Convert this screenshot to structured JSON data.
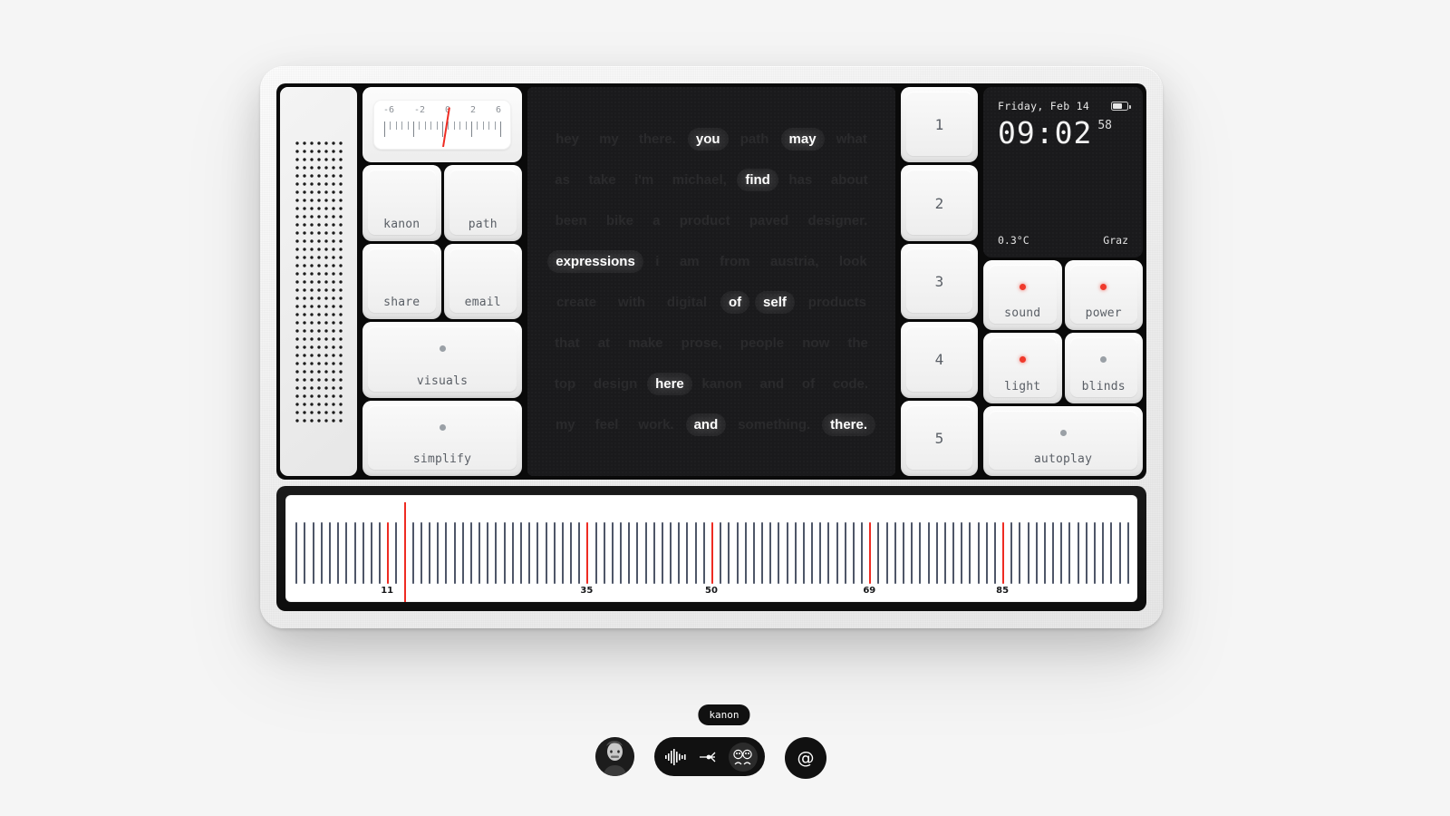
{
  "device": {
    "meter": {
      "scale_labels": [
        "-6",
        "-2",
        "0",
        "2",
        "6"
      ],
      "needle_value": "0"
    },
    "left_keys": [
      {
        "label": "kanon",
        "led": null
      },
      {
        "label": "path",
        "led": null
      },
      {
        "label": "share",
        "led": null
      },
      {
        "label": "email",
        "led": null
      },
      {
        "label": "visuals",
        "led": "off"
      },
      {
        "label": "simplify",
        "led": "off"
      }
    ],
    "number_keys": [
      "1",
      "2",
      "3",
      "4",
      "5"
    ],
    "right_keys": [
      {
        "label": "sound",
        "led": "on"
      },
      {
        "label": "power",
        "led": "on"
      },
      {
        "label": "light",
        "led": "on"
      },
      {
        "label": "blinds",
        "led": "off"
      },
      {
        "label": "autoplay",
        "led": "off"
      }
    ],
    "clock": {
      "date": "Friday, Feb 14",
      "time": "09:02",
      "seconds": "58",
      "temperature": "0.3°C",
      "location": "Graz",
      "battery_icon": "battery-icon"
    },
    "display": {
      "rows": [
        [
          {
            "text": "hey",
            "active": false
          },
          {
            "text": "my",
            "active": false
          },
          {
            "text": "there.",
            "active": false
          },
          {
            "text": "you",
            "active": true
          },
          {
            "text": "path",
            "active": false
          },
          {
            "text": "may",
            "active": true
          },
          {
            "text": "what",
            "active": false
          }
        ],
        [
          {
            "text": "as",
            "active": false
          },
          {
            "text": "take",
            "active": false
          },
          {
            "text": "i'm",
            "active": false
          },
          {
            "text": "michael,",
            "active": false
          },
          {
            "text": "find",
            "active": true
          },
          {
            "text": "has",
            "active": false
          },
          {
            "text": "about",
            "active": false
          }
        ],
        [
          {
            "text": "been",
            "active": false
          },
          {
            "text": "bike",
            "active": false
          },
          {
            "text": "a",
            "active": false
          },
          {
            "text": "product",
            "active": false
          },
          {
            "text": "paved",
            "active": false
          },
          {
            "text": "designer.",
            "active": false
          }
        ],
        [
          {
            "text": "expressions",
            "active": true
          },
          {
            "text": "i",
            "active": false
          },
          {
            "text": "am",
            "active": false
          },
          {
            "text": "from",
            "active": false
          },
          {
            "text": "austria,",
            "active": false
          },
          {
            "text": "look",
            "active": false
          }
        ],
        [
          {
            "text": "create",
            "active": false
          },
          {
            "text": "with",
            "active": false
          },
          {
            "text": "digital",
            "active": false
          },
          {
            "text": "of",
            "active": true
          },
          {
            "text": "self",
            "active": true
          },
          {
            "text": "products",
            "active": false
          }
        ],
        [
          {
            "text": "that",
            "active": false
          },
          {
            "text": "at",
            "active": false
          },
          {
            "text": "make",
            "active": false
          },
          {
            "text": "prose,",
            "active": false
          },
          {
            "text": "people",
            "active": false
          },
          {
            "text": "now",
            "active": false
          },
          {
            "text": "the",
            "active": false
          }
        ],
        [
          {
            "text": "top",
            "active": false
          },
          {
            "text": "design",
            "active": false
          },
          {
            "text": "here",
            "active": true
          },
          {
            "text": "kanon",
            "active": false
          },
          {
            "text": "and",
            "active": false
          },
          {
            "text": "of",
            "active": false
          },
          {
            "text": "code.",
            "active": false
          }
        ],
        [
          {
            "text": "my",
            "active": false
          },
          {
            "text": "feel",
            "active": false
          },
          {
            "text": "work.",
            "active": false
          },
          {
            "text": "and",
            "active": true
          },
          {
            "text": "something.",
            "active": false
          },
          {
            "text": "there.",
            "active": true
          }
        ]
      ]
    },
    "ruler": {
      "min": 0,
      "max": 100,
      "marker_labels": [
        "11",
        "35",
        "50",
        "69",
        "85"
      ],
      "marker_values": [
        11,
        35,
        50,
        69,
        85
      ],
      "tick_color": "#4e5668",
      "marker_color": "#ee2b22"
    }
  },
  "dock": {
    "tooltip": "kanon",
    "avatar_name": "avatar",
    "items": [
      {
        "icon": "waveform-icon",
        "selected": false
      },
      {
        "icon": "node-fork-icon",
        "selected": false
      },
      {
        "icon": "faces-icon",
        "selected": true
      }
    ],
    "at_button": "@"
  }
}
